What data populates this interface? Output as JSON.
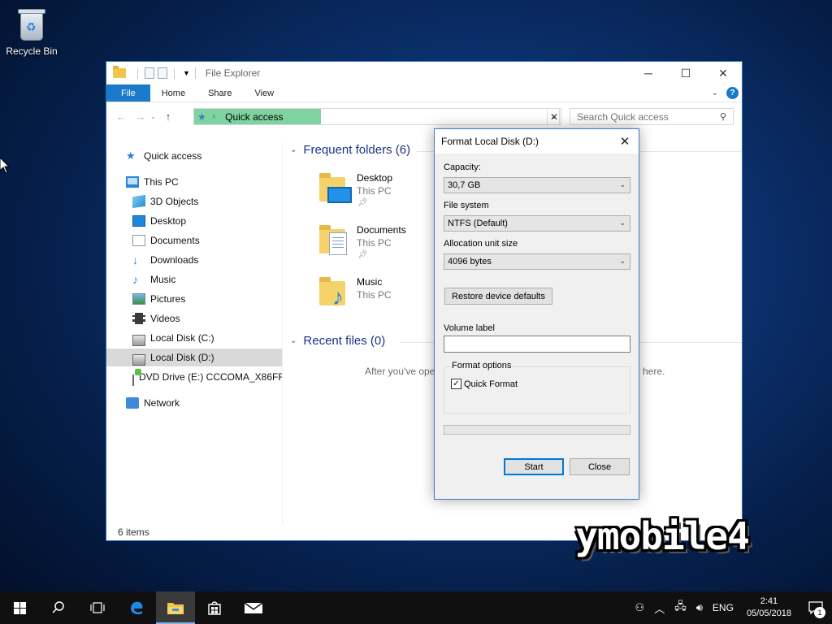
{
  "desktop": {
    "recycle_bin_label": "Recycle Bin"
  },
  "explorer": {
    "title": "File Explorer",
    "ribbon_tabs": [
      "File",
      "Home",
      "Share",
      "View"
    ],
    "address": {
      "current": "Quick access"
    },
    "search": {
      "placeholder": "Search Quick access"
    },
    "nav_pane": [
      {
        "label": "Quick access",
        "icon": "star-icon"
      },
      {
        "label": "This PC",
        "icon": "computer-icon"
      },
      {
        "label": "3D Objects",
        "icon": "cube-icon"
      },
      {
        "label": "Desktop",
        "icon": "desktop-icon"
      },
      {
        "label": "Documents",
        "icon": "document-icon"
      },
      {
        "label": "Downloads",
        "icon": "download-icon"
      },
      {
        "label": "Music",
        "icon": "music-icon"
      },
      {
        "label": "Pictures",
        "icon": "pictures-icon"
      },
      {
        "label": "Videos",
        "icon": "video-icon"
      },
      {
        "label": "Local Disk (C:)",
        "icon": "drive-icon"
      },
      {
        "label": "Local Disk (D:)",
        "icon": "drive-icon",
        "selected": true
      },
      {
        "label": "DVD Drive (E:) CCCOMA_X86FR",
        "icon": "dvd-icon"
      },
      {
        "label": "Network",
        "icon": "network-icon"
      }
    ],
    "frequent_header": "Frequent folders (6)",
    "frequent_folders": [
      {
        "name": "Desktop",
        "location": "This PC",
        "pinned": true
      },
      {
        "name": "Documents",
        "location": "This PC",
        "pinned": true
      },
      {
        "name": "Music",
        "location": "This PC",
        "pinned": false
      }
    ],
    "recent_header": "Recent files (0)",
    "recent_message_start": "After you've ope",
    "recent_message_end": "here.",
    "status": "6 items"
  },
  "format_dialog": {
    "title": "Format Local Disk (D:)",
    "capacity_label": "Capacity:",
    "capacity_value": "30,7 GB",
    "filesystem_label": "File system",
    "filesystem_value": "NTFS (Default)",
    "allocation_label": "Allocation unit size",
    "allocation_value": "4096 bytes",
    "restore_button": "Restore device defaults",
    "volume_label": "Volume label",
    "volume_value": "",
    "format_options_label": "Format options",
    "quick_format_label": "Quick Format",
    "quick_format_checked": true,
    "progress_fraction": 0,
    "start_button": "Start",
    "close_button": "Close"
  },
  "watermark": "ymobile4",
  "taskbar": {
    "language": "ENG",
    "time": "2:41",
    "date": "05/05/2018",
    "notification_count": "1"
  }
}
